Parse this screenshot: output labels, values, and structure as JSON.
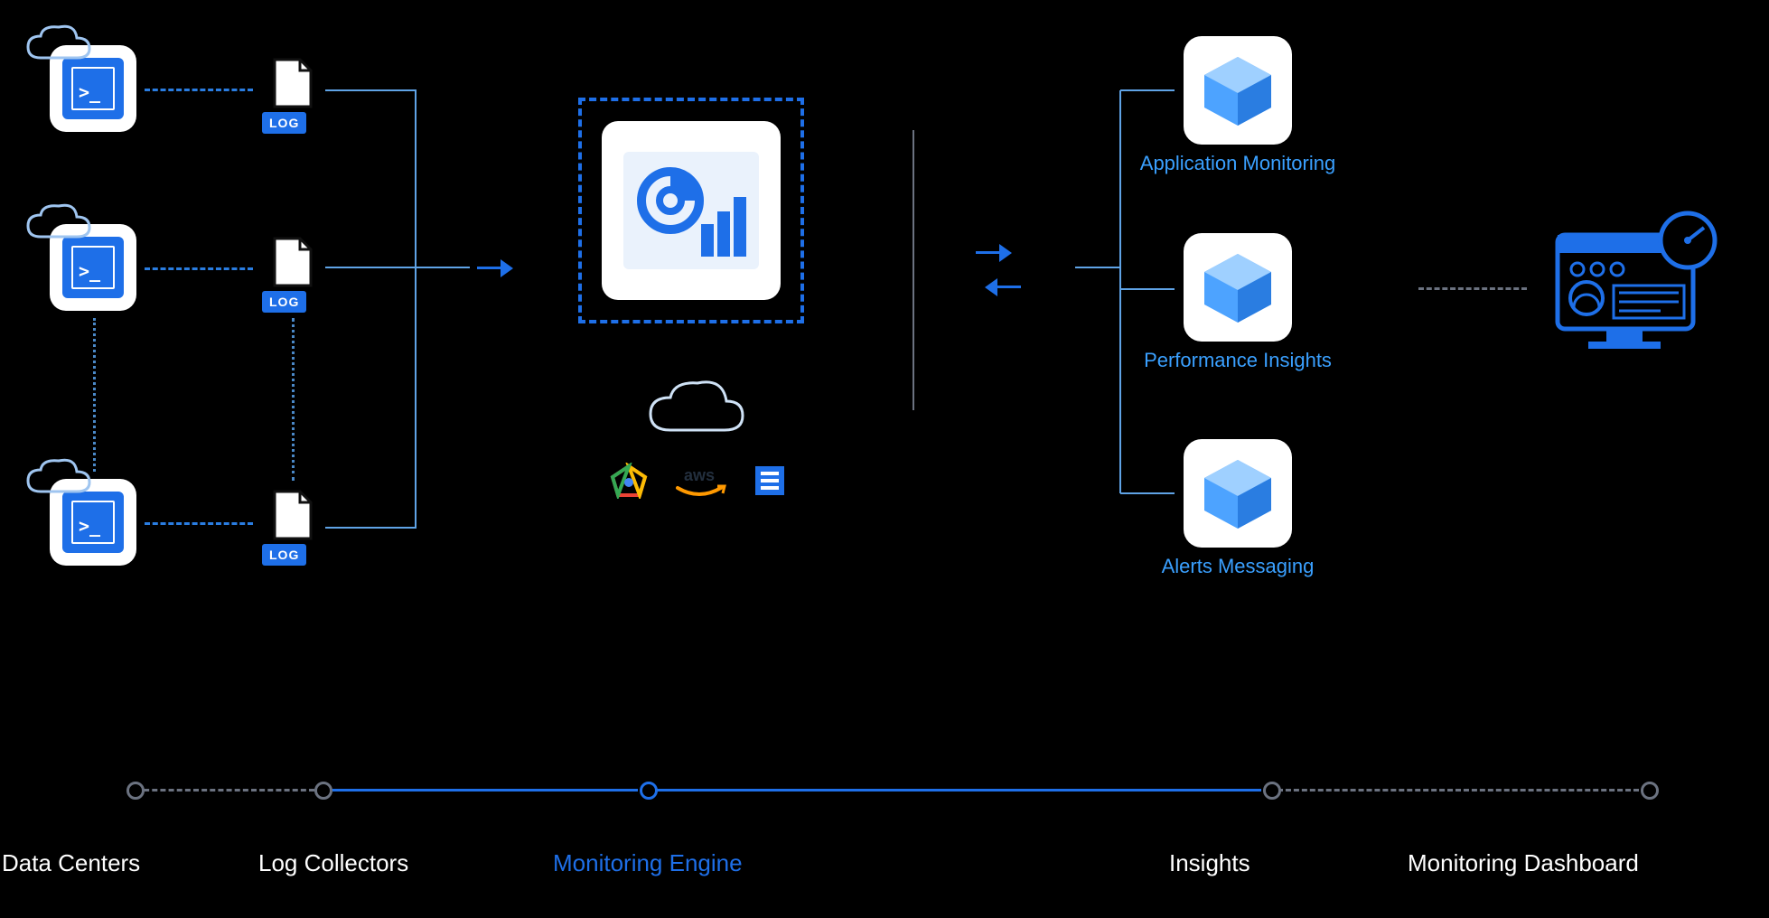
{
  "columns": {
    "data_centers": {
      "label": "Data Centers",
      "terminal_prompt": ">_"
    },
    "log_collectors": {
      "label": "Log Collectors",
      "badge": "LOG"
    },
    "monitoring_engine": {
      "label": "Monitoring Engine",
      "providers": {
        "gcp": "gcp",
        "aws": "aws",
        "azure": "azure"
      }
    },
    "insights": {
      "label": "Insights",
      "tiles": [
        {
          "id": "application_monitoring",
          "label": "Application Monitoring"
        },
        {
          "id": "performance_insights",
          "label": "Performance Insights"
        },
        {
          "id": "alerts_messaging",
          "label": "Alerts Messaging"
        }
      ]
    },
    "monitoring_dashboard": {
      "label": "Monitoring Dashboard"
    }
  },
  "timeline": {
    "steps": [
      "data_centers",
      "log_collectors",
      "monitoring_engine",
      "insights",
      "monitoring_dashboard"
    ],
    "active": "monitoring_engine"
  },
  "colors": {
    "accent": "#1e6fe8",
    "accent_light": "#3aa0ff",
    "muted": "#6b7280"
  }
}
